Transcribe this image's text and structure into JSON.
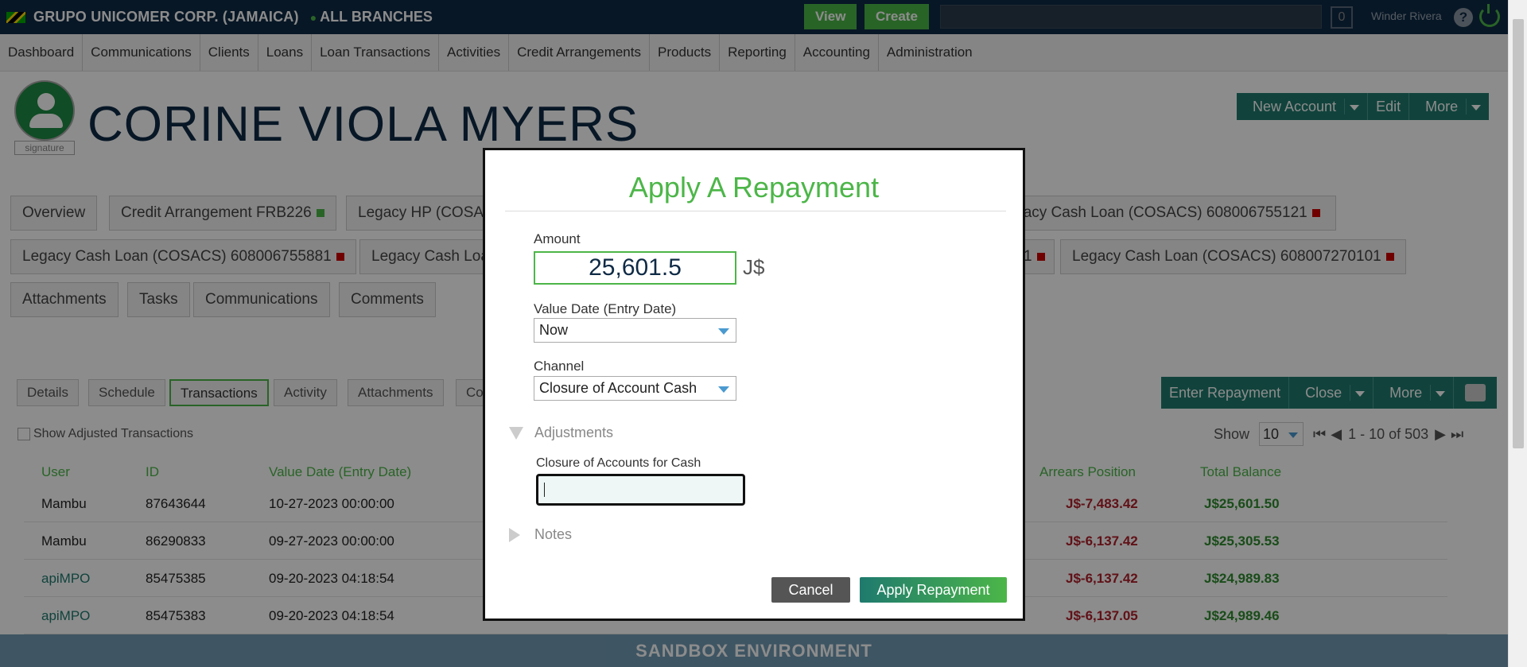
{
  "topbar": {
    "org": "GRUPO UNICOMER CORP. (JAMAICA)",
    "branch": "ALL BRANCHES",
    "view_label": "View",
    "create_label": "Create",
    "notif_count": "0",
    "user": "Winder Rivera",
    "help": "?"
  },
  "nav": [
    "Dashboard",
    "Communications",
    "Clients",
    "Loans",
    "Loan Transactions",
    "Activities",
    "Credit Arrangements",
    "Products",
    "Reporting",
    "Accounting",
    "Administration"
  ],
  "client": {
    "name": "CORINE VIOLA MYERS",
    "signature_label": "signature",
    "actions": {
      "new_account": "New Account",
      "edit": "Edit",
      "more": "More"
    }
  },
  "account_tabs": {
    "overview": "Overview",
    "credit_arrangement": "Credit Arrangement FRB226",
    "legacy_hp": "Legacy HP (COSAC",
    "legacy_cash_1": "Legacy Cash Loan (COSACS) 608006755121",
    "legacy_cash_2": "Legacy Cash Loan (COSACS) 608006755881",
    "legacy_cash_3": "Legacy Cash Loa",
    "legacy_cash_4_suffix": "1",
    "legacy_cash_5": "Legacy Cash Loan (COSACS) 608007270101",
    "attachments": "Attachments",
    "tasks": "Tasks",
    "communications": "Communications",
    "comments": "Comments"
  },
  "subtabs": [
    "Details",
    "Schedule",
    "Transactions",
    "Activity",
    "Attachments",
    "Co"
  ],
  "trans_actions": {
    "enter_repayment": "Enter Repayment",
    "close": "Close",
    "more": "More"
  },
  "show_adjusted": "Show Adjusted Transactions",
  "paging": {
    "show_label": "Show",
    "page_size": "10",
    "range": "1 - 10 of 503"
  },
  "table": {
    "headers": {
      "user": "User",
      "id": "ID",
      "value_date": "Value Date (Entry Date)",
      "arrears": "Arrears Position",
      "total_balance": "Total Balance"
    },
    "rows": [
      {
        "user": "Mambu",
        "id": "87643644",
        "date": "10-27-2023 00:00:00",
        "arrears": "J$-7,483.42",
        "balance": "J$25,601.50"
      },
      {
        "user": "Mambu",
        "id": "86290833",
        "date": "09-27-2023 00:00:00",
        "arrears": "J$-6,137.42",
        "balance": "J$25,305.53"
      },
      {
        "user": "apiMPO",
        "id": "85475385",
        "date": "09-20-2023 04:18:54",
        "arrears": "J$-6,137.42",
        "balance": "J$24,989.83"
      },
      {
        "user": "apiMPO",
        "id": "85475383",
        "date": "09-20-2023 04:18:54",
        "arrears": "J$-6,137.05",
        "balance": "J$24,989.46"
      }
    ]
  },
  "sandbox_label": "SANDBOX ENVIRONMENT",
  "modal": {
    "title": "Apply A Repayment",
    "amount_label": "Amount",
    "amount_value": "25,601.5",
    "currency": "J$",
    "value_date_label": "Value Date (Entry Date)",
    "value_date_value": "Now",
    "channel_label": "Channel",
    "channel_value": "Closure of Account Cash",
    "adjustments_label": "Adjustments",
    "closure_field_label": "Closure of Accounts for Cash",
    "notes_label": "Notes",
    "cancel_label": "Cancel",
    "apply_label": "Apply Repayment"
  },
  "colors": {
    "brand_green": "#4cb648",
    "teal": "#1f7a6e",
    "navy": "#0f2a45",
    "arrears_red": "#b0202a"
  }
}
